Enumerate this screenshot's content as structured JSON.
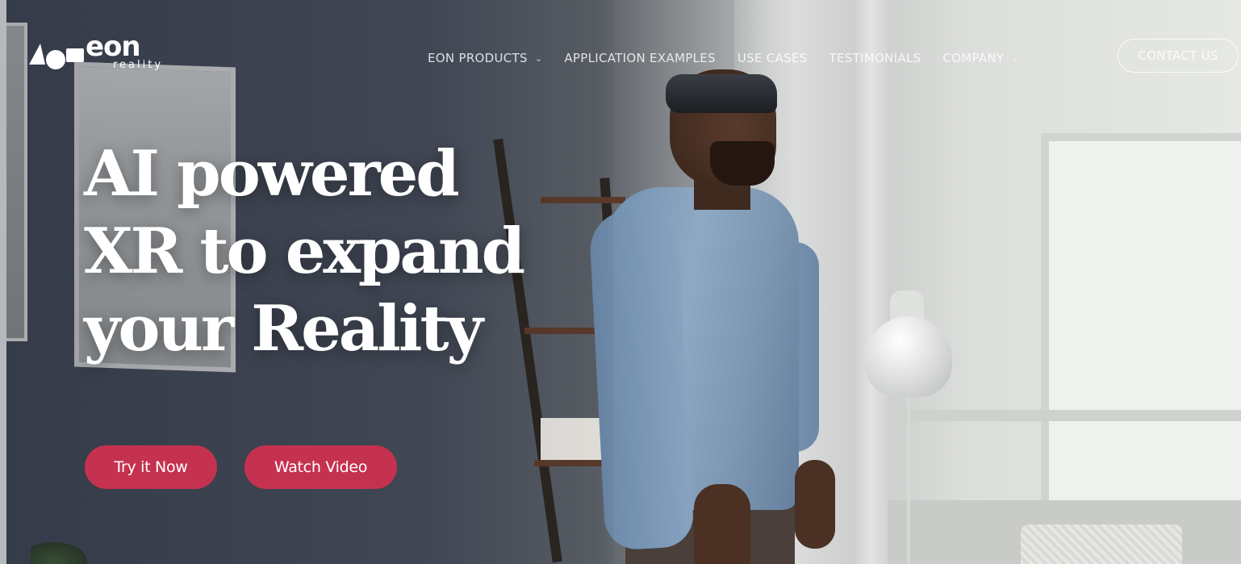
{
  "brand": {
    "name": "eon",
    "tagline": "reality"
  },
  "nav": {
    "items": [
      {
        "label": "EON PRODUCTS",
        "has_dropdown": true
      },
      {
        "label": "APPLICATION EXAMPLES",
        "has_dropdown": false
      },
      {
        "label": "USE CASES",
        "has_dropdown": false
      },
      {
        "label": "TESTIMONIALS",
        "has_dropdown": false
      },
      {
        "label": "COMPANY",
        "has_dropdown": true
      }
    ],
    "contact_label": "CONTACT US"
  },
  "hero": {
    "headline_lines": [
      "AI powered",
      "XR to expand",
      "your Reality"
    ],
    "primary_cta": "Try it Now",
    "secondary_cta": "Watch Video"
  },
  "colors": {
    "accent": "#c5324f",
    "text_light": "#ffffff"
  },
  "icons": {
    "dropdown": "chevron-down-icon"
  }
}
